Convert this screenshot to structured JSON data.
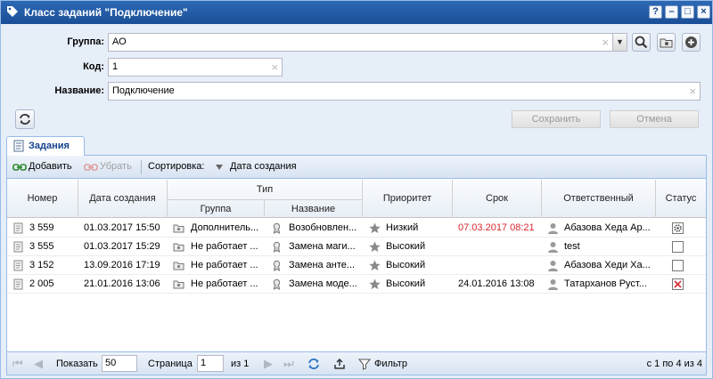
{
  "window": {
    "title": "Класс заданий \"Подключение\"",
    "buttons": [
      "?",
      "–",
      "□",
      "×"
    ]
  },
  "form": {
    "group_label": "Группа:",
    "group_value": "АО",
    "code_label": "Код:",
    "code_value": "1",
    "name_label": "Название:",
    "name_value": "Подключение",
    "save_label": "Сохранить",
    "cancel_label": "Отмена"
  },
  "tab": {
    "label": "Задания"
  },
  "toolbar": {
    "add_label": "Добавить",
    "remove_label": "Убрать",
    "sort_label": "Сортировка:",
    "sort_field": "Дата создания"
  },
  "grid": {
    "headers": {
      "number": "Номер",
      "created": "Дата создания",
      "type": "Тип",
      "group": "Группа",
      "name": "Название",
      "priority": "Приоритет",
      "due": "Срок",
      "responsible": "Ответственный",
      "status": "Статус"
    },
    "rows": [
      {
        "number": "3 559",
        "created": "01.03.2017 15:50",
        "group": "Дополнитель...",
        "name": "Возобновлен...",
        "priority": "Низкий",
        "due": "07.03.2017 08:21",
        "responsible": "Абазова Хеда Ар...",
        "status": "in-progress"
      },
      {
        "number": "3 555",
        "created": "01.03.2017 15:29",
        "group": "Не работает ...",
        "name": "Замена маги...",
        "priority": "Высокий",
        "due": "",
        "responsible": "test",
        "status": "empty"
      },
      {
        "number": "3 152",
        "created": "13.09.2016 17:19",
        "group": "Не работает ...",
        "name": "Замена анте...",
        "priority": "Высокий",
        "due": "",
        "responsible": "Абазова Хеди Ха...",
        "status": "empty"
      },
      {
        "number": "2 005",
        "created": "21.01.2016 13:06",
        "group": "Не работает ...",
        "name": "Замена моде...",
        "priority": "Высокий",
        "due": "24.01.2016 13:08",
        "responsible": "Татарханов Руст...",
        "status": "cancelled"
      }
    ]
  },
  "pager": {
    "show_label": "Показать",
    "page_size": "50",
    "page_label": "Страница",
    "page_value": "1",
    "of_label": "из 1",
    "filter_label": "Фильтр",
    "summary": "с 1 по 4 из 4"
  },
  "colors": {
    "overdue": "#d9272e",
    "accent": "#15428b"
  }
}
